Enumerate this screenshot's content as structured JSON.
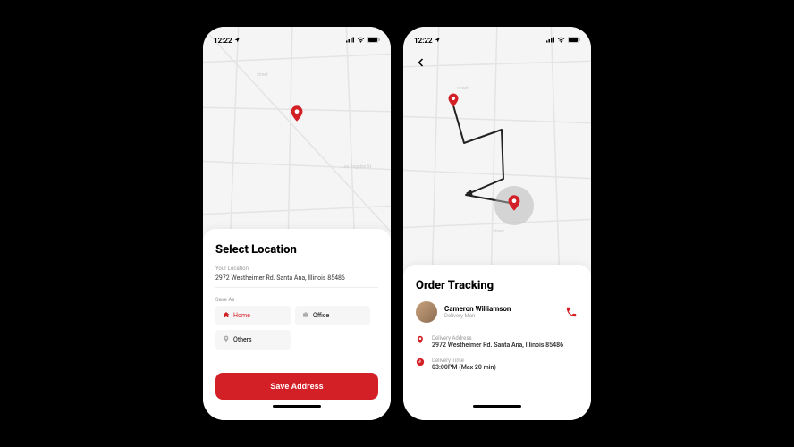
{
  "status": {
    "time": "12:22"
  },
  "screen1": {
    "title": "Select Location",
    "location_label": "Your Location",
    "location_value": "2972 Westheimer Rd. Santa Ana, Illinois 85486",
    "save_as_label": "Save As",
    "chips": {
      "home": "Home",
      "office": "Office",
      "others": "Others"
    },
    "save_button": "Save Address"
  },
  "screen2": {
    "title": "Order Tracking",
    "driver": {
      "name": "Cameron Williamson",
      "role": "Delivery Man"
    },
    "address": {
      "label": "Delivery Address",
      "value": "2972 Westheimer Rd. Santa Ana, Illinois 85486"
    },
    "time": {
      "label": "Delivery Time",
      "value": "03:00PM (Max 20 min)"
    }
  }
}
